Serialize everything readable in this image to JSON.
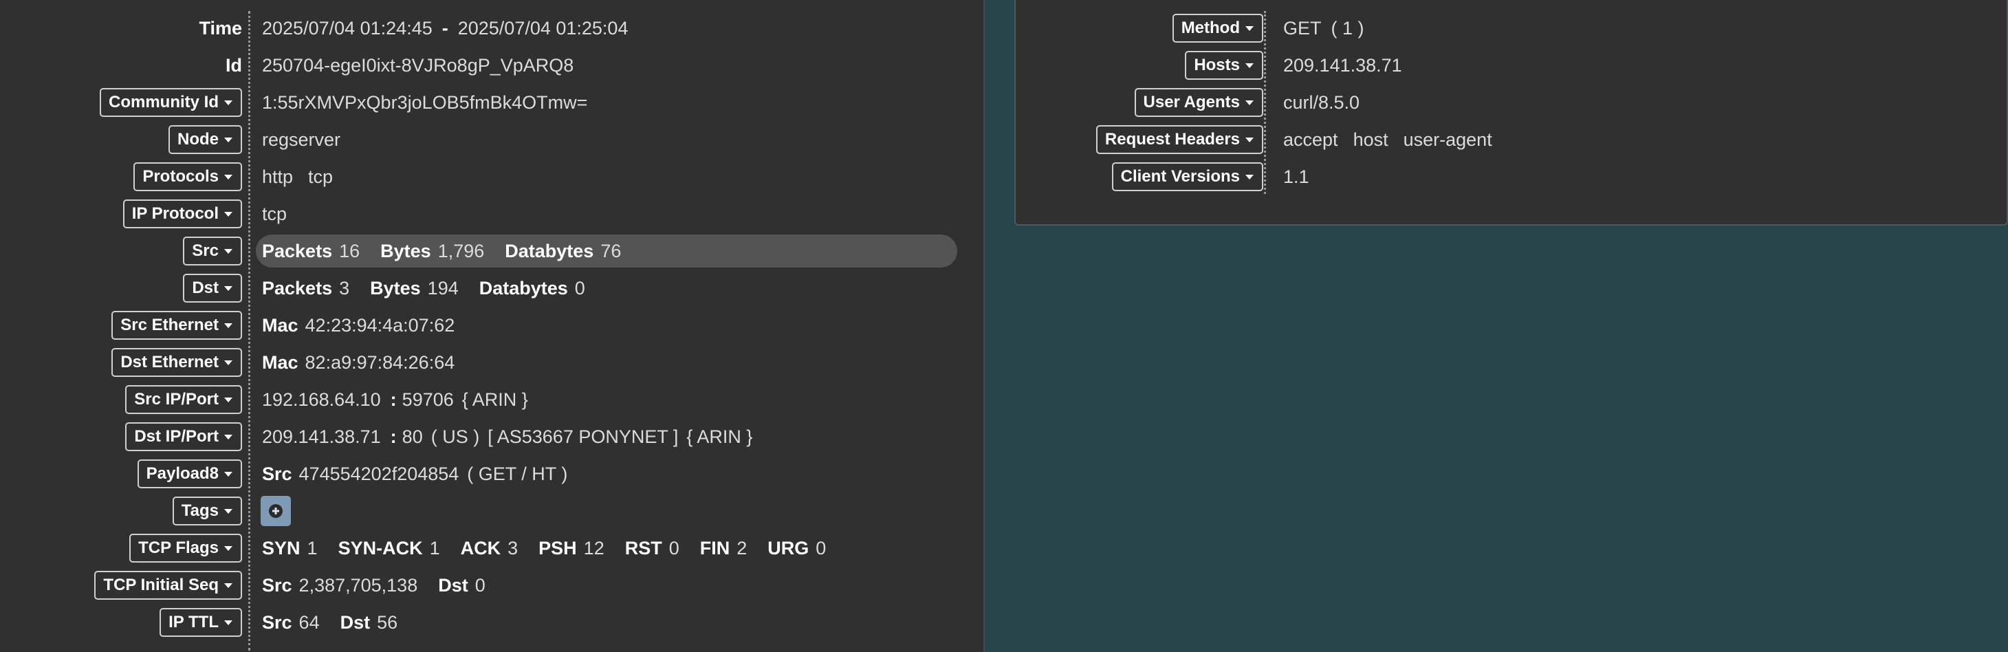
{
  "time": {
    "label": "Time",
    "start": "2025/07/04 01:24:45",
    "sep": "-",
    "end": "2025/07/04 01:25:04"
  },
  "id": {
    "label": "Id",
    "value": "250704-egeI0ixt-8VJRo8gP_VpARQ8"
  },
  "community_id": {
    "label": "Community Id",
    "value": "1:55rXMVPxQbr3joLOB5fmBk4OTmw="
  },
  "node": {
    "label": "Node",
    "value": "regserver"
  },
  "protocols": {
    "label": "Protocols",
    "values": [
      "http",
      "tcp"
    ]
  },
  "ip_protocol": {
    "label": "IP Protocol",
    "value": "tcp"
  },
  "src": {
    "label": "Src",
    "packets_label": "Packets",
    "packets": "16",
    "bytes_label": "Bytes",
    "bytes": "1,796",
    "databytes_label": "Databytes",
    "databytes": "76"
  },
  "dst": {
    "label": "Dst",
    "packets_label": "Packets",
    "packets": "3",
    "bytes_label": "Bytes",
    "bytes": "194",
    "databytes_label": "Databytes",
    "databytes": "0"
  },
  "src_ethernet": {
    "label": "Src Ethernet",
    "mac_label": "Mac",
    "mac": "42:23:94:4a:07:62"
  },
  "dst_ethernet": {
    "label": "Dst Ethernet",
    "mac_label": "Mac",
    "mac": "82:a9:97:84:26:64"
  },
  "src_ip_port": {
    "label": "Src IP/Port",
    "ip": "192.168.64.10",
    "colon": ":",
    "port": "59706",
    "rir": "{ ARIN }"
  },
  "dst_ip_port": {
    "label": "Dst IP/Port",
    "ip": "209.141.38.71",
    "colon": ":",
    "port": "80",
    "country": "( US )",
    "asn": "[ AS53667 PONYNET ]",
    "rir": "{ ARIN }"
  },
  "payload8": {
    "label": "Payload8",
    "src_label": "Src",
    "hex": "474554202f204854",
    "ascii": "( GET / HT )"
  },
  "tags": {
    "label": "Tags",
    "add_icon": "plus-circle-icon"
  },
  "tcp_flags": {
    "label": "TCP Flags",
    "flags": [
      {
        "name": "SYN",
        "count": "1"
      },
      {
        "name": "SYN-ACK",
        "count": "1"
      },
      {
        "name": "ACK",
        "count": "3"
      },
      {
        "name": "PSH",
        "count": "12"
      },
      {
        "name": "RST",
        "count": "0"
      },
      {
        "name": "FIN",
        "count": "2"
      },
      {
        "name": "URG",
        "count": "0"
      }
    ]
  },
  "tcp_initial_seq": {
    "label": "TCP Initial Seq",
    "src_label": "Src",
    "src": "2,387,705,138",
    "dst_label": "Dst",
    "dst": "0"
  },
  "ip_ttl": {
    "label": "IP TTL",
    "src_label": "Src",
    "src": "64",
    "dst_label": "Dst",
    "dst": "56"
  },
  "http": {
    "method": {
      "label": "Method",
      "value": "GET",
      "count": "( 1 )"
    },
    "hosts": {
      "label": "Hosts",
      "value": "209.141.38.71"
    },
    "user_agents": {
      "label": "User Agents",
      "value": "curl/8.5.0"
    },
    "request_headers": {
      "label": "Request Headers",
      "values": [
        "accept",
        "host",
        "user-agent"
      ]
    },
    "client_versions": {
      "label": "Client Versions",
      "value": "1.1"
    }
  },
  "colors": {
    "page_bg": "#264449",
    "panel_bg": "#303030",
    "highlight_row": "#545454",
    "tag_button": "#7f9ab5"
  }
}
